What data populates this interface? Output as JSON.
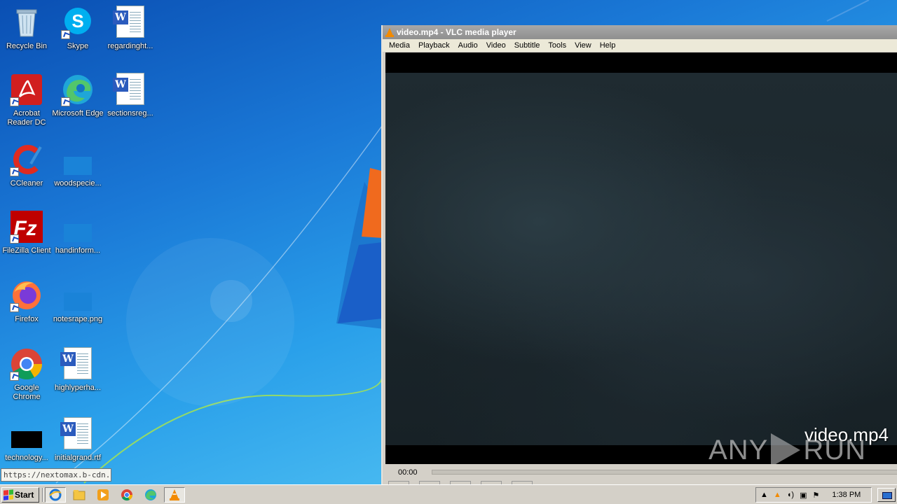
{
  "desktop": {
    "icons": [
      {
        "label": "Recycle Bin",
        "icon": "recycle-bin-icon"
      },
      {
        "label": "Skype",
        "icon": "skype-icon"
      },
      {
        "label": "regardinght...",
        "icon": "word-doc-icon"
      },
      {
        "label": "Acrobat Reader DC",
        "icon": "acrobat-icon"
      },
      {
        "label": "Microsoft Edge",
        "icon": "edge-icon"
      },
      {
        "label": "sectionsreg...",
        "icon": "word-doc-icon"
      },
      {
        "label": "CCleaner",
        "icon": "ccleaner-icon"
      },
      {
        "label": "woodspecie...",
        "icon": "file-icon"
      },
      {
        "label": "FileZilla Client",
        "icon": "filezilla-icon"
      },
      {
        "label": "handinform...",
        "icon": "file-icon"
      },
      {
        "label": "Firefox",
        "icon": "firefox-icon"
      },
      {
        "label": "notesrape.png",
        "icon": "image-file-icon"
      },
      {
        "label": "Google Chrome",
        "icon": "chrome-icon"
      },
      {
        "label": "highlyperha...",
        "icon": "word-doc-icon"
      },
      {
        "label": "technology...",
        "icon": "black-file-icon"
      },
      {
        "label": "initialgrand.rtf",
        "icon": "word-doc-icon"
      }
    ]
  },
  "vlc": {
    "title": "video.mp4 - VLC media player",
    "menu": [
      "Media",
      "Playback",
      "Audio",
      "Video",
      "Subtitle",
      "Tools",
      "View",
      "Help"
    ],
    "osd_filename": "video.mp4",
    "time_elapsed": "00:00",
    "progress": 0
  },
  "watermark": {
    "left": "ANY",
    "right": "RUN"
  },
  "tooltip": {
    "text": "https://nextomax.b-cdn...."
  },
  "taskbar": {
    "start_label": "Start",
    "pinned": [
      "ie-icon",
      "explorer-icon",
      "media-player-icon",
      "chrome-icon",
      "edge-icon",
      "vlc-icon"
    ],
    "clock": "1:38 PM"
  },
  "colors": {
    "vlc_orange": "#f28a00",
    "desktop_blue": "#1a78d6"
  }
}
